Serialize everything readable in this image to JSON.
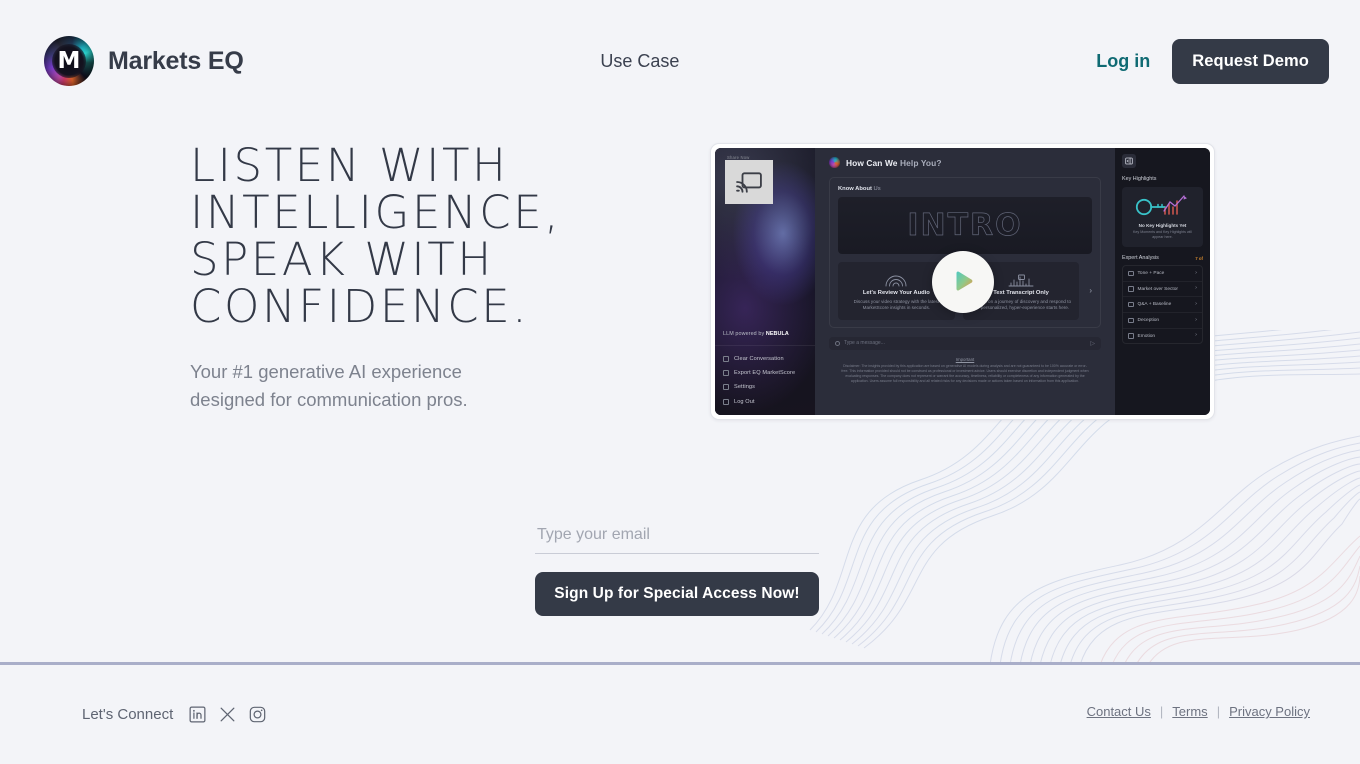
{
  "brand": {
    "name": "Markets EQ",
    "logo_letter": "M",
    "logo_icon": "markets-eq-orb-logo"
  },
  "colors": {
    "page_background": "#f3f4f8",
    "text_primary": "#333947",
    "text_muted": "#7d828e",
    "login_teal": "#0f6a73",
    "button_dark": "#343a47",
    "footer_divider": "#a9aec9"
  },
  "header": {
    "nav_center_label": "Use Case",
    "login_label": "Log in",
    "demo_button_label": "Request Demo"
  },
  "hero": {
    "title": "LISTEN WITH\nINTELLIGENCE,\nSPEAK WITH\nCONFIDENCE.",
    "subtitle": "Your #1 generative AI experience\ndesigned for communication pros."
  },
  "video": {
    "play_icon": "play-triangle-icon",
    "cast_icon": "screen-cast-icon",
    "screen_share_label": "Share Now",
    "app": {
      "sidebar": {
        "powered_by_prefix": "LLM powered by ",
        "powered_by_brand": "NEBULA",
        "menu": [
          {
            "label": "Clear Conversation",
            "icon": "trash-icon"
          },
          {
            "label": "Export EQ MarketScore",
            "icon": "export-icon"
          },
          {
            "label": "Settings",
            "icon": "gear-icon"
          },
          {
            "label": "Log Out",
            "icon": "logout-icon"
          }
        ]
      },
      "center": {
        "heading_strong": "How Can We Help You?",
        "heading_bold_part": "How Can We",
        "heading_light_part": " Help You?",
        "panel_label_bold": "Know About",
        "panel_label_light": " Us",
        "intro_word": "INTRO",
        "options": [
          {
            "title": "Let's Review Your Audio",
            "desc": "Discuss your video strategy with the latest MarketScore insights in seconds.",
            "icon": "audio-wave-icon"
          },
          {
            "title": "Text Transcript Only",
            "desc": "Embark on a journey of discovery and respond to our personalized, hyper-experience starts here.",
            "icon": "transcript-chart-icon"
          }
        ],
        "options_next_icon": "chevron-right-icon",
        "chat_placeholder": "Type a message...",
        "chat_send_icon": "send-icon",
        "disclaimer_title": "Important",
        "disclaimer_body": "Disclaimer: The insights provided by this application are based on generative AI models during analysis and are not guaranteed to be 100% accurate or error-free. This information provided should not be construed as professional or investment advice. Users should exercise discretion and independent judgment when evaluating responses. The company does not represent or warrant the accuracy, timeliness, reliability or completeness of any information generated by the application. Users assume full responsibility and all related risks for any decisions made or actions taken based on information from this application."
      },
      "rail": {
        "collapse_icon": "panel-collapse-icon",
        "highlights_title": "Key Highlights",
        "highlights_card_title": "No Key Highlights Yet",
        "highlights_card_sub": "Key Moments and Key Highlights will appear here.",
        "highlights_art_icon": "key-chart-icon",
        "analysis_title": "Expert Analysis",
        "analysis_badge": "7 of",
        "analysis_items": [
          {
            "label": "Tone + Pace",
            "icon": "tone-icon"
          },
          {
            "label": "Market over Sector",
            "icon": "market-icon"
          },
          {
            "label": "Q&A + Baseline",
            "icon": "qa-icon"
          },
          {
            "label": "Deception",
            "icon": "deception-icon"
          },
          {
            "label": "Emotion",
            "icon": "emotion-icon"
          }
        ],
        "item_chevron": "chevron-right-icon"
      }
    }
  },
  "signup": {
    "email_placeholder": "Type your email",
    "email_value": "",
    "button_label": "Sign Up for Special Access Now!"
  },
  "footer": {
    "connect_label": "Let's Connect",
    "socials": [
      {
        "name": "linkedin-icon",
        "label": "LinkedIn"
      },
      {
        "name": "x-twitter-icon",
        "label": "X"
      },
      {
        "name": "instagram-icon",
        "label": "Instagram"
      }
    ],
    "legal_links": [
      {
        "label": "Contact Us"
      },
      {
        "label": "Terms"
      },
      {
        "label": "Privacy Policy"
      }
    ],
    "legal_separator": "|"
  }
}
